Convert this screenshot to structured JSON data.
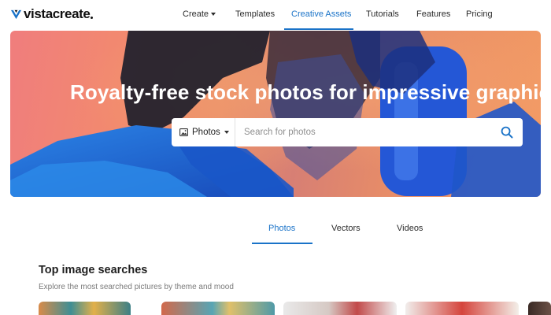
{
  "brand": {
    "name": "vistacreate"
  },
  "nav": {
    "items": [
      {
        "label": "Create",
        "has_caret": true
      },
      {
        "label": "Templates"
      },
      {
        "label": "Creative Assets",
        "active": true
      },
      {
        "label": "Tutorials"
      },
      {
        "label": "Features"
      },
      {
        "label": "Pricing"
      }
    ]
  },
  "hero": {
    "title": "Royalty-free stock photos for impressive graphics",
    "search": {
      "type_label": "Photos",
      "placeholder": "Search for photos",
      "value": ""
    }
  },
  "content_tabs": [
    {
      "label": "Photos",
      "active": true
    },
    {
      "label": "Vectors"
    },
    {
      "label": "Videos"
    }
  ],
  "section": {
    "title": "Top image searches",
    "subtitle": "Explore the most searched pictures by theme and mood"
  },
  "colors": {
    "accent": "#1a73c8",
    "hero_gradient_start": "#f07d7d",
    "hero_gradient_end": "#f29a63",
    "hero_blue": "#1f5fd6"
  },
  "icons": {
    "logo": "vistacreate-logo-mark",
    "search_type": "image-icon",
    "search": "magnifier-icon"
  }
}
